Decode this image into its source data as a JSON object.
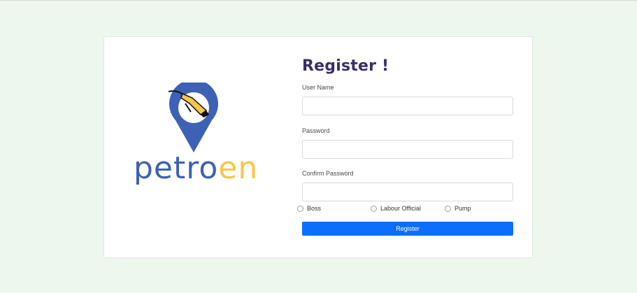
{
  "brand": {
    "part1": "petro",
    "part2": "en",
    "primary_color": "#3d62b5",
    "accent_color": "#f7c64a",
    "icon": "fuel-pump-map-pin-icon"
  },
  "form": {
    "title": "Register !",
    "fields": [
      {
        "label": "User Name",
        "value": "",
        "placeholder": ""
      },
      {
        "label": "Password",
        "value": "",
        "placeholder": ""
      },
      {
        "label": "Confirm Password",
        "value": "",
        "placeholder": ""
      }
    ],
    "roles": [
      "Boss",
      "Labour Official",
      "Pump"
    ],
    "submit_label": "Register",
    "submit_color": "#0d6efd"
  }
}
